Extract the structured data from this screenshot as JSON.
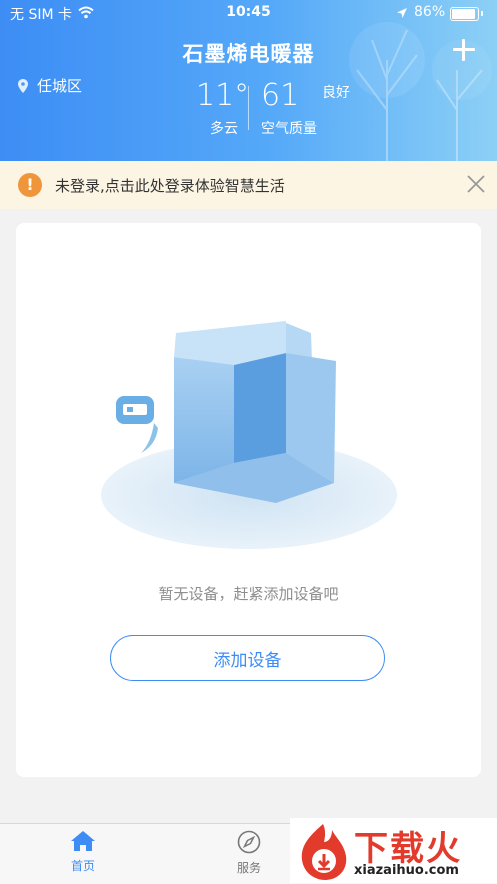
{
  "status_bar": {
    "carrier": "无 SIM 卡",
    "time": "10:45",
    "battery": "86%"
  },
  "header": {
    "title": "石墨烯电暖器",
    "location": "任城区",
    "temperature": "11°",
    "weather": "多云",
    "aqi": "61",
    "aqi_label": "空气质量",
    "aqi_level": "良好"
  },
  "notice": {
    "text": "未登录,点击此处登录体验智慧生活"
  },
  "empty_state": {
    "text": "暂无设备，赶紧添加设备吧",
    "button": "添加设备"
  },
  "tabbar": {
    "tabs": [
      {
        "label": "首页",
        "icon": "home-icon",
        "active": true
      },
      {
        "label": "服务",
        "icon": "compass-icon",
        "active": false
      }
    ]
  },
  "watermark": {
    "text": "下载火",
    "url": "xiazaihuo.com"
  },
  "colors": {
    "accent": "#3d8df5",
    "warning": "#f0963a",
    "notice_bg": "#fdf5e3",
    "watermark_red": "#e23a2b"
  }
}
